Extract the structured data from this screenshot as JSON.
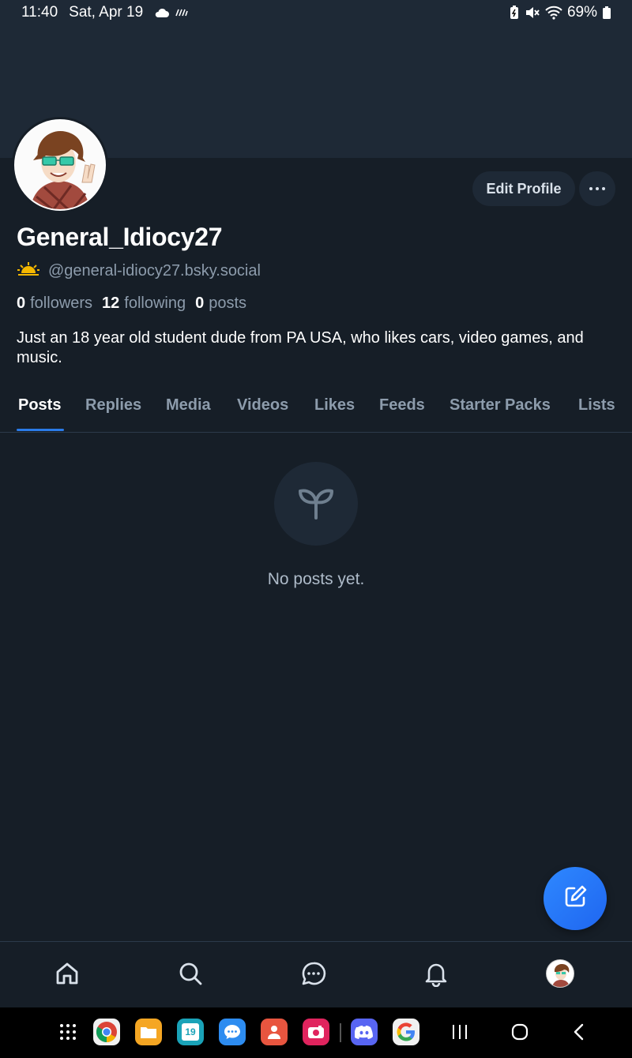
{
  "status_bar": {
    "time": "11:40",
    "date": "Sat, Apr 19",
    "battery": "69%"
  },
  "profile": {
    "display_name": "General_Idiocy27",
    "handle": "@general-idiocy27.bsky.social",
    "edit_label": "Edit Profile",
    "bio": "Just an 18 year old student dude from PA USA, who likes cars, video games, and music.",
    "stats": {
      "followers_count": "0",
      "followers_label": "followers",
      "following_count": "12",
      "following_label": "following",
      "posts_count": "0",
      "posts_label": "posts"
    }
  },
  "tabs": [
    {
      "label": "Posts",
      "active": true
    },
    {
      "label": "Replies"
    },
    {
      "label": "Media"
    },
    {
      "label": "Videos"
    },
    {
      "label": "Likes"
    },
    {
      "label": "Feeds"
    },
    {
      "label": "Starter Packs"
    },
    {
      "label": "Lists"
    }
  ],
  "empty_state": {
    "icon": "sprout-icon",
    "text": "No posts yet."
  },
  "bottom_nav": [
    "home-icon",
    "search-icon",
    "chat-icon",
    "bell-icon",
    "profile-avatar"
  ],
  "dock_apps": [
    "apps-grid-icon",
    "chrome-icon",
    "files-icon",
    "calendar-icon",
    "messages-icon",
    "contacts-icon",
    "camera-icon",
    "discord-icon",
    "google-icon"
  ],
  "calendar_day": "19",
  "colors": {
    "background": "#161e27",
    "banner": "#1e2936",
    "accent": "#2a7be8",
    "muted_text": "#8d9cac"
  }
}
